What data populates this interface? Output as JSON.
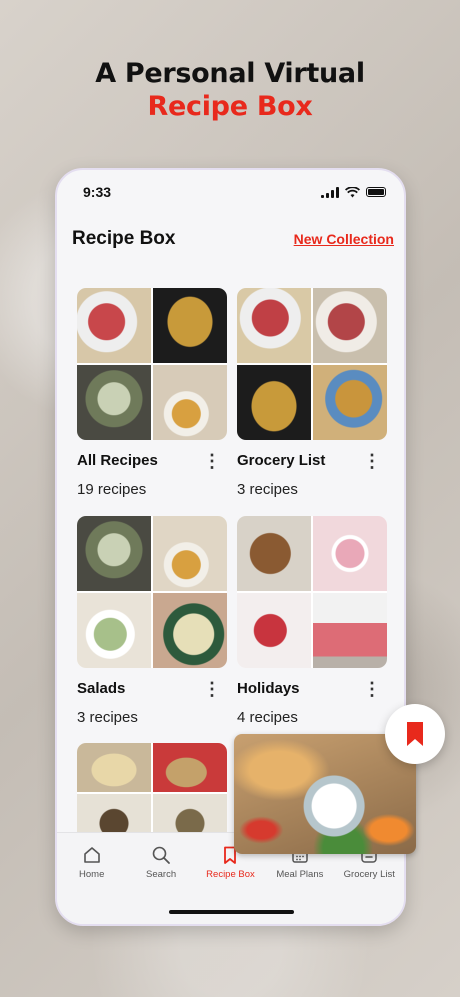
{
  "headline": {
    "line1": "A Personal Virtual",
    "line2": "Recipe Box"
  },
  "status": {
    "time": "9:33"
  },
  "header": {
    "title": "Recipe Box",
    "new_collection": "New Collection"
  },
  "collections": [
    {
      "name": "All Recipes",
      "count": "19 recipes",
      "colors": [
        "#c8474b",
        "#b8913a",
        "#6f7a5a",
        "#d7cbb8"
      ]
    },
    {
      "name": "Grocery List",
      "count": "3 recipes",
      "colors": [
        "#c04045",
        "#b24548",
        "#c89a3a",
        "#d0b07a"
      ]
    },
    {
      "name": "Salads",
      "count": "3 recipes",
      "colors": [
        "#7f8f6a",
        "#e0d6c5",
        "#a7c08a",
        "#e6dfb8"
      ]
    },
    {
      "name": "Holidays",
      "count": "4 recipes",
      "colors": [
        "#8a5a32",
        "#e9a8b8",
        "#c8343e",
        "#dd6c76"
      ]
    },
    {
      "name": "",
      "count": "",
      "colors": [
        "#e8d7a8",
        "#c93a3a",
        "#c4a16a",
        "#e6e1d6"
      ]
    }
  ],
  "tabs": [
    {
      "label": "Home",
      "icon": "home-icon"
    },
    {
      "label": "Search",
      "icon": "search-icon"
    },
    {
      "label": "Recipe Box",
      "icon": "bookmark-icon"
    },
    {
      "label": "Meal Plans",
      "icon": "calendar-icon"
    },
    {
      "label": "Grocery List",
      "icon": "list-icon"
    }
  ],
  "accent": "#e8291c"
}
